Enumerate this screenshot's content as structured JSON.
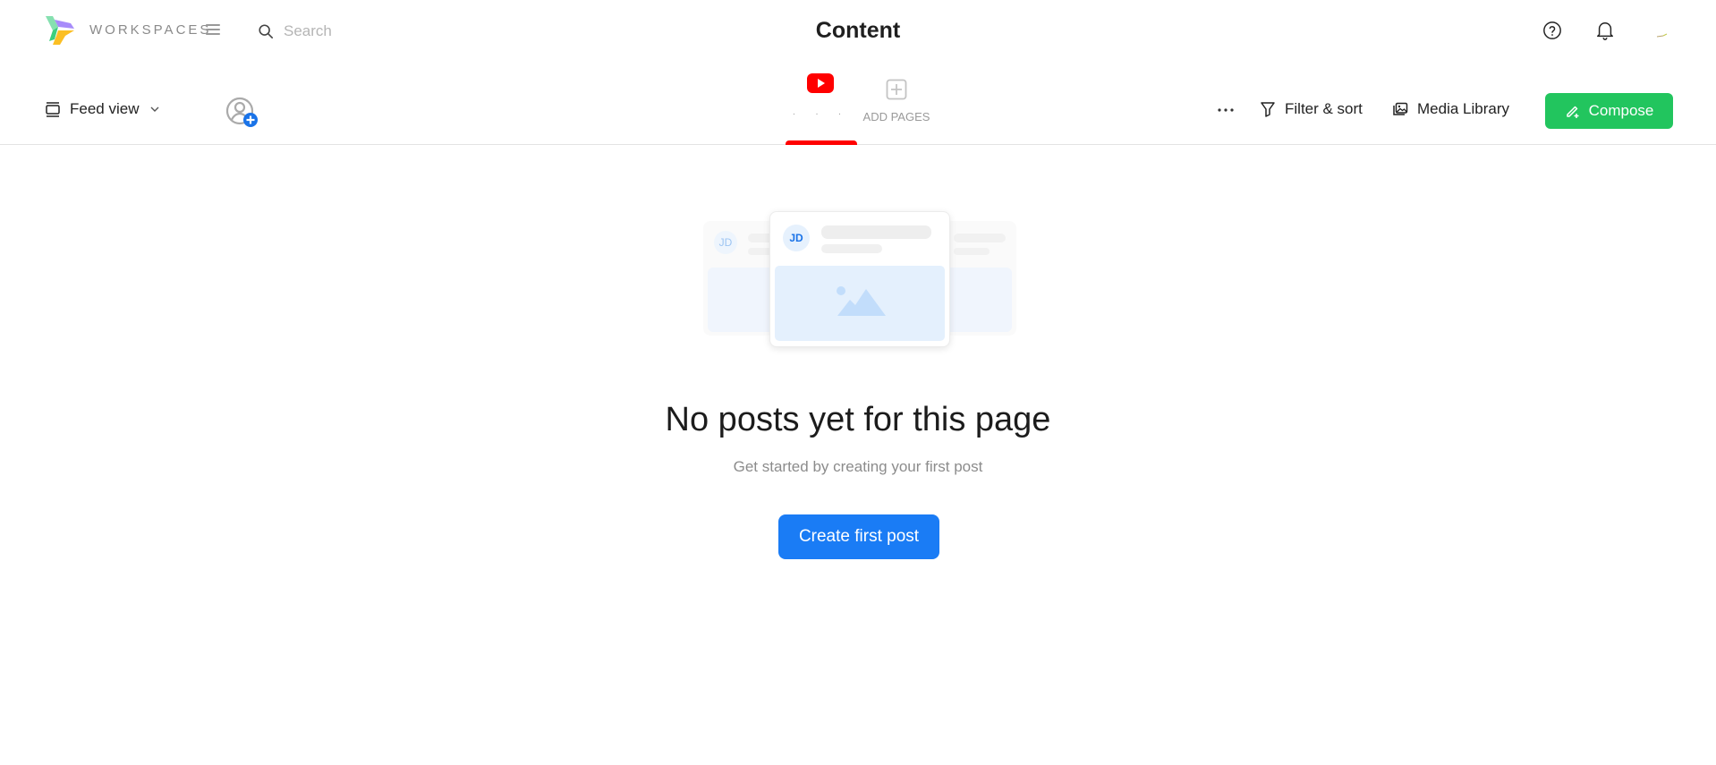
{
  "header": {
    "brand": "WORKSPACES",
    "search_placeholder": "Search",
    "title": "Content"
  },
  "toolbar": {
    "feed_view_label": "Feed view",
    "tabs": [
      {
        "label": ". . .",
        "icon": "youtube-icon",
        "active": true,
        "accent": "#ff0000"
      },
      {
        "label": "ADD PAGES",
        "icon": "plus-square-icon",
        "active": false
      }
    ],
    "filter_label": "Filter & sort",
    "media_library_label": "Media Library",
    "compose_label": "Compose",
    "compose_color": "#22c55e"
  },
  "illustration": {
    "avatar_initials": "JD"
  },
  "empty_state": {
    "title": "No posts yet for this page",
    "subtitle": "Get started by creating your first post",
    "cta_label": "Create first post",
    "cta_color": "#1a7cf5"
  }
}
